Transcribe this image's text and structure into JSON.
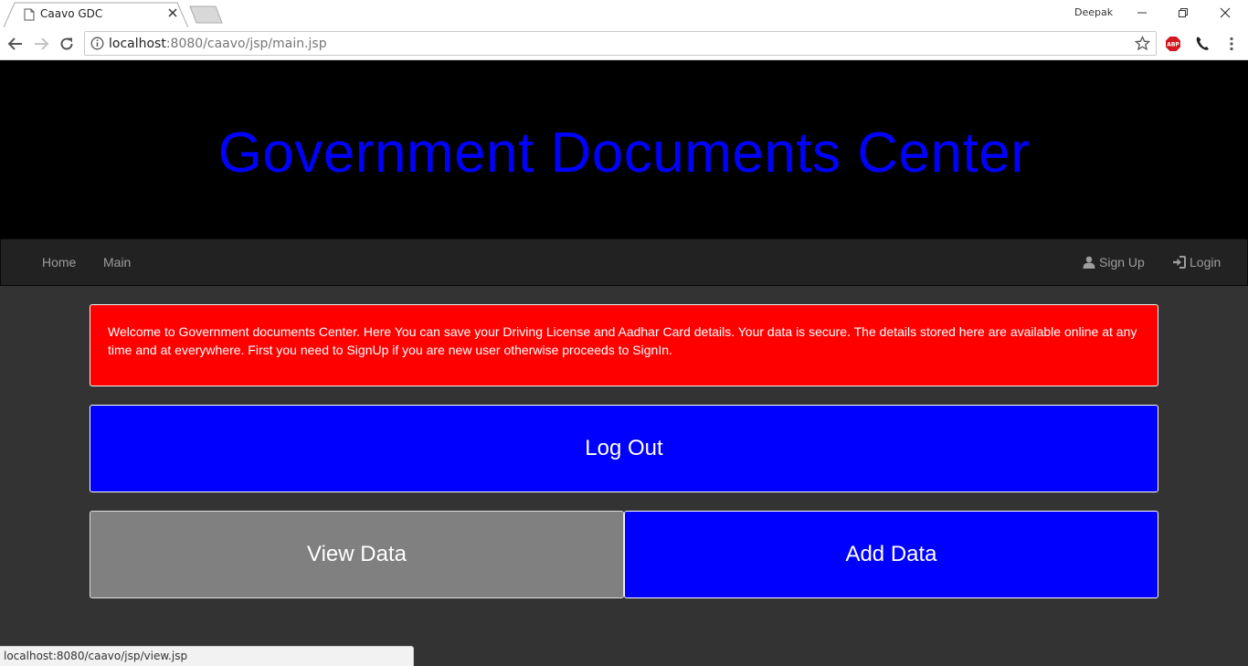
{
  "browser": {
    "tab_title": "Caavo GDC",
    "profile_name": "Deepak",
    "url_host": "localhost",
    "url_rest": ":8080/caavo/jsp/main.jsp",
    "extension_badge": "ABP",
    "status_url": "localhost:8080/caavo/jsp/view.jsp"
  },
  "header": {
    "title": "Government Documents Center"
  },
  "navbar": {
    "left": [
      {
        "label": "Home"
      },
      {
        "label": "Main"
      }
    ],
    "right": [
      {
        "label": "Sign Up",
        "icon": "user-icon"
      },
      {
        "label": "Login",
        "icon": "login-icon"
      }
    ]
  },
  "alert": {
    "text": "Welcome to Government documents Center. Here You can save your Driving License and Aadhar Card details. Your data is secure. The details stored here are available online at any time and at everywhere. First you need to SignUp if you are new user otherwise proceeds to SignIn."
  },
  "actions": {
    "logout": "Log Out",
    "view": "View Data",
    "add": "Add Data"
  },
  "colors": {
    "title": "#0000ff",
    "alert_bg": "#ff0000",
    "primary_button": "#0000ff",
    "secondary_button": "#808080",
    "page_bg": "#333333",
    "navbar_bg": "#222222"
  }
}
